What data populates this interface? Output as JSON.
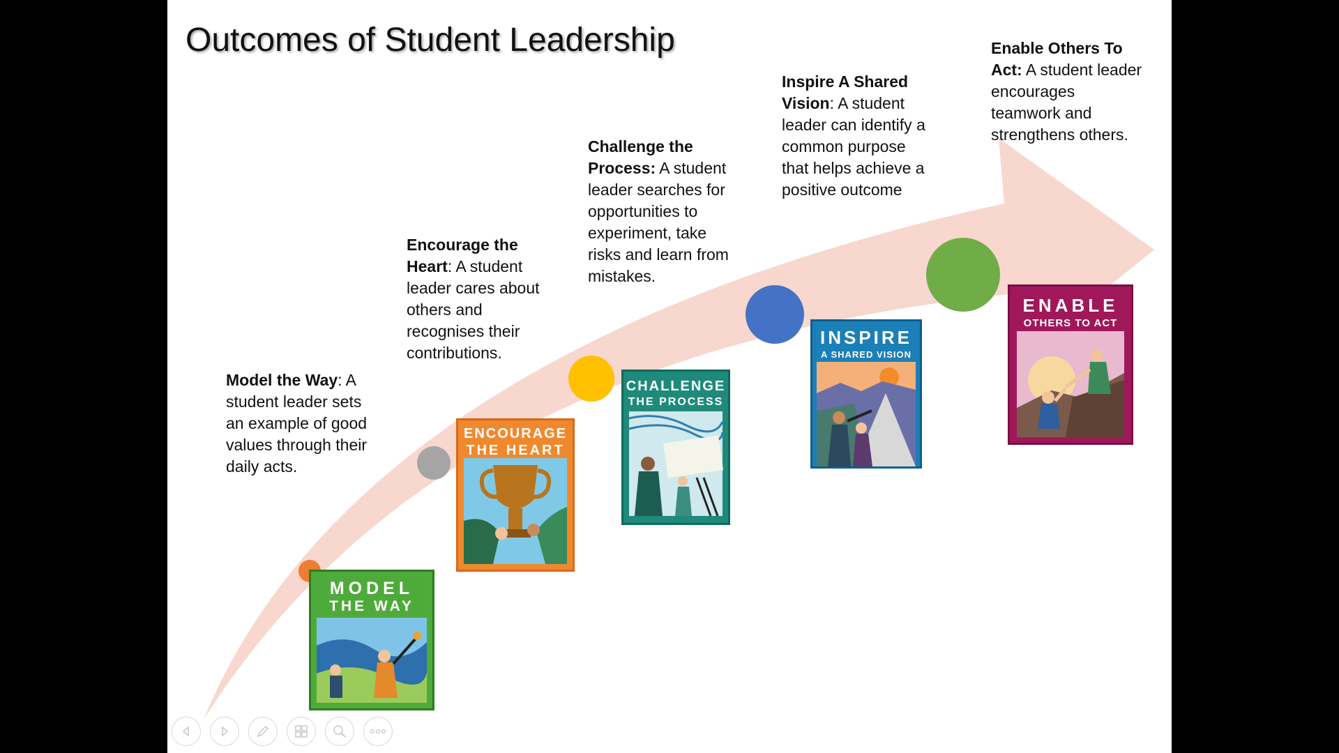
{
  "slide": {
    "title": "Outcomes of Student Leadership"
  },
  "steps": [
    {
      "id": "model",
      "heading": "Model the Way",
      "separator": ":",
      "body": " A student leader sets an example of good values through their daily acts.",
      "dot_color": "#ED7D31",
      "card_line1": "MODEL",
      "card_line2": "THE WAY",
      "card_color": "#4EAA3A",
      "card_border": "#2E7D1F"
    },
    {
      "id": "encourage",
      "heading": "Encourage the Heart",
      "separator": ":",
      "body": " A student leader cares about others and recognises their contributions.",
      "dot_color": "#A5A5A5",
      "card_line1": "ENCOURAGE",
      "card_line2": "THE HEART",
      "card_color": "#F0892E",
      "card_border": "#D9691A"
    },
    {
      "id": "challenge",
      "heading": "Challenge the Process:",
      "separator": "",
      "body": " A student leader searches for opportunities to experiment, take risks and learn from mistakes.",
      "dot_color": "#FFC000",
      "card_line1": "CHALLENGE",
      "card_line2": "THE PROCESS",
      "card_color": "#1F8A7A",
      "card_border": "#0F6A5C"
    },
    {
      "id": "inspire",
      "heading": "Inspire A Shared Vision",
      "separator": ":",
      "body": " A student leader can identify a common purpose that helps achieve a positive outcome",
      "dot_color": "#4472C4",
      "card_line1": "INSPIRE",
      "card_line2": "A SHARED VISION",
      "card_color": "#1B7FB8",
      "card_border": "#105E8C"
    },
    {
      "id": "enable",
      "heading": "Enable Others To Act:",
      "separator": "",
      "body": " A student leader encourages teamwork and strengthens others.",
      "dot_color": "#70AD47",
      "card_line1": "ENABLE",
      "card_line2": "OTHERS TO ACT",
      "card_color": "#A0185A",
      "card_border": "#7A0F42"
    }
  ],
  "colors": {
    "arrow": "#F8D7CE",
    "background": "#FFFFFF",
    "frame": "#000000"
  },
  "nav": [
    {
      "icon": "previous-icon"
    },
    {
      "icon": "next-icon"
    },
    {
      "icon": "pen-icon"
    },
    {
      "icon": "slides-grid-icon"
    },
    {
      "icon": "zoom-icon"
    },
    {
      "icon": "more-options-icon"
    }
  ]
}
